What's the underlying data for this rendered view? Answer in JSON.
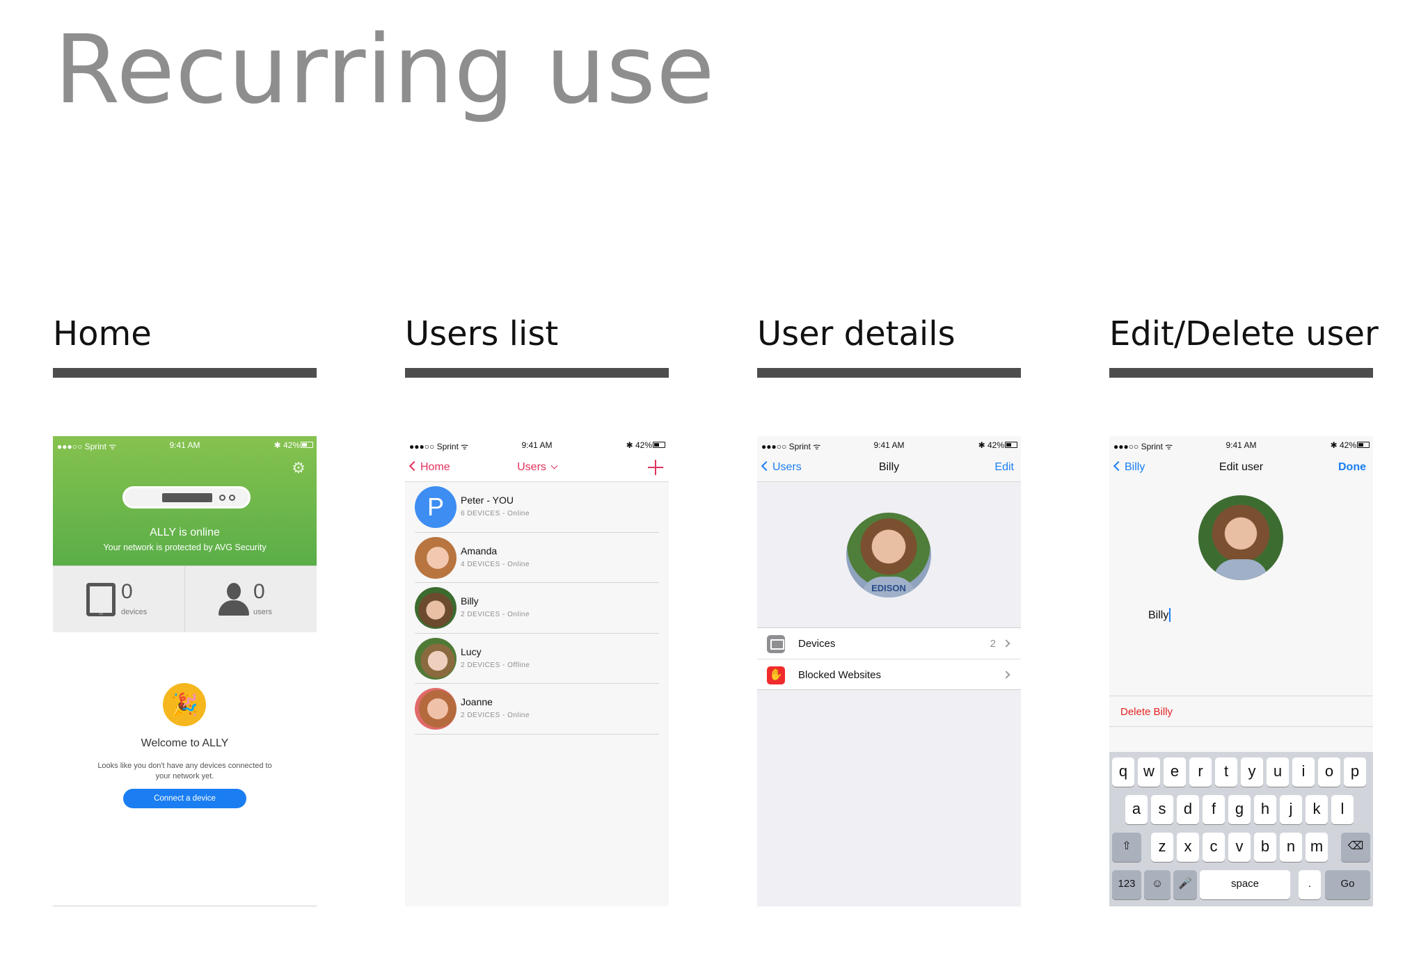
{
  "page": {
    "title": "Recurring use",
    "columns": [
      {
        "title": "Home"
      },
      {
        "title": "Users list"
      },
      {
        "title": "User details"
      },
      {
        "title": "Edit/Delete user"
      }
    ]
  },
  "status_bar": {
    "carrier": "●●●○○ Sprint ᯤ",
    "time": "9:41 AM",
    "battery": "✱ 42%"
  },
  "home": {
    "gear_icon": "gear-icon",
    "status_title": "ALLY is online",
    "status_sub": "Your network is protected by AVG Security",
    "devices_count": "0",
    "devices_label": "devices",
    "users_count": "0",
    "users_label": "users",
    "welcome_title": "Welcome to ALLY",
    "welcome_sub": "Looks like you don't have any devices connected to your network yet.",
    "connect_button": "Connect a device",
    "colors": {
      "hero_green": "#6cb84b",
      "button_blue": "#1a7ef2"
    }
  },
  "users_list": {
    "back_label": "Home",
    "title": "Users",
    "users": [
      {
        "name": "Peter - YOU",
        "meta": "6 DEVICES - Online",
        "initial": "P"
      },
      {
        "name": "Amanda",
        "meta": "4 DEVICES - Online"
      },
      {
        "name": "Billy",
        "meta": "2 DEVICES - Online"
      },
      {
        "name": "Lucy",
        "meta": "2 DEVICES - Offline"
      },
      {
        "name": "Joanne",
        "meta": "2 DEVICES - Online"
      }
    ],
    "colors": {
      "accent": "#e3315c"
    }
  },
  "user_details": {
    "back_label": "Users",
    "title": "Billy",
    "edit_label": "Edit",
    "shirt_text": "EDISON",
    "cells": [
      {
        "label": "Devices",
        "value": "2"
      },
      {
        "label": "Blocked Websites",
        "value": ""
      }
    ]
  },
  "edit_user": {
    "back_label": "Billy",
    "title": "Edit user",
    "done_label": "Done",
    "name_value": "Billy",
    "delete_label": "Delete Billy",
    "keyboard": {
      "row1": [
        "q",
        "w",
        "e",
        "r",
        "t",
        "y",
        "u",
        "i",
        "o",
        "p"
      ],
      "row2": [
        "a",
        "s",
        "d",
        "f",
        "g",
        "h",
        "j",
        "k",
        "l"
      ],
      "row3": [
        "z",
        "x",
        "c",
        "v",
        "b",
        "n",
        "m"
      ],
      "num_label": "123",
      "space_label": "space",
      "period_label": ".",
      "go_label": "Go"
    },
    "colors": {
      "delete_red": "#e32222"
    }
  }
}
